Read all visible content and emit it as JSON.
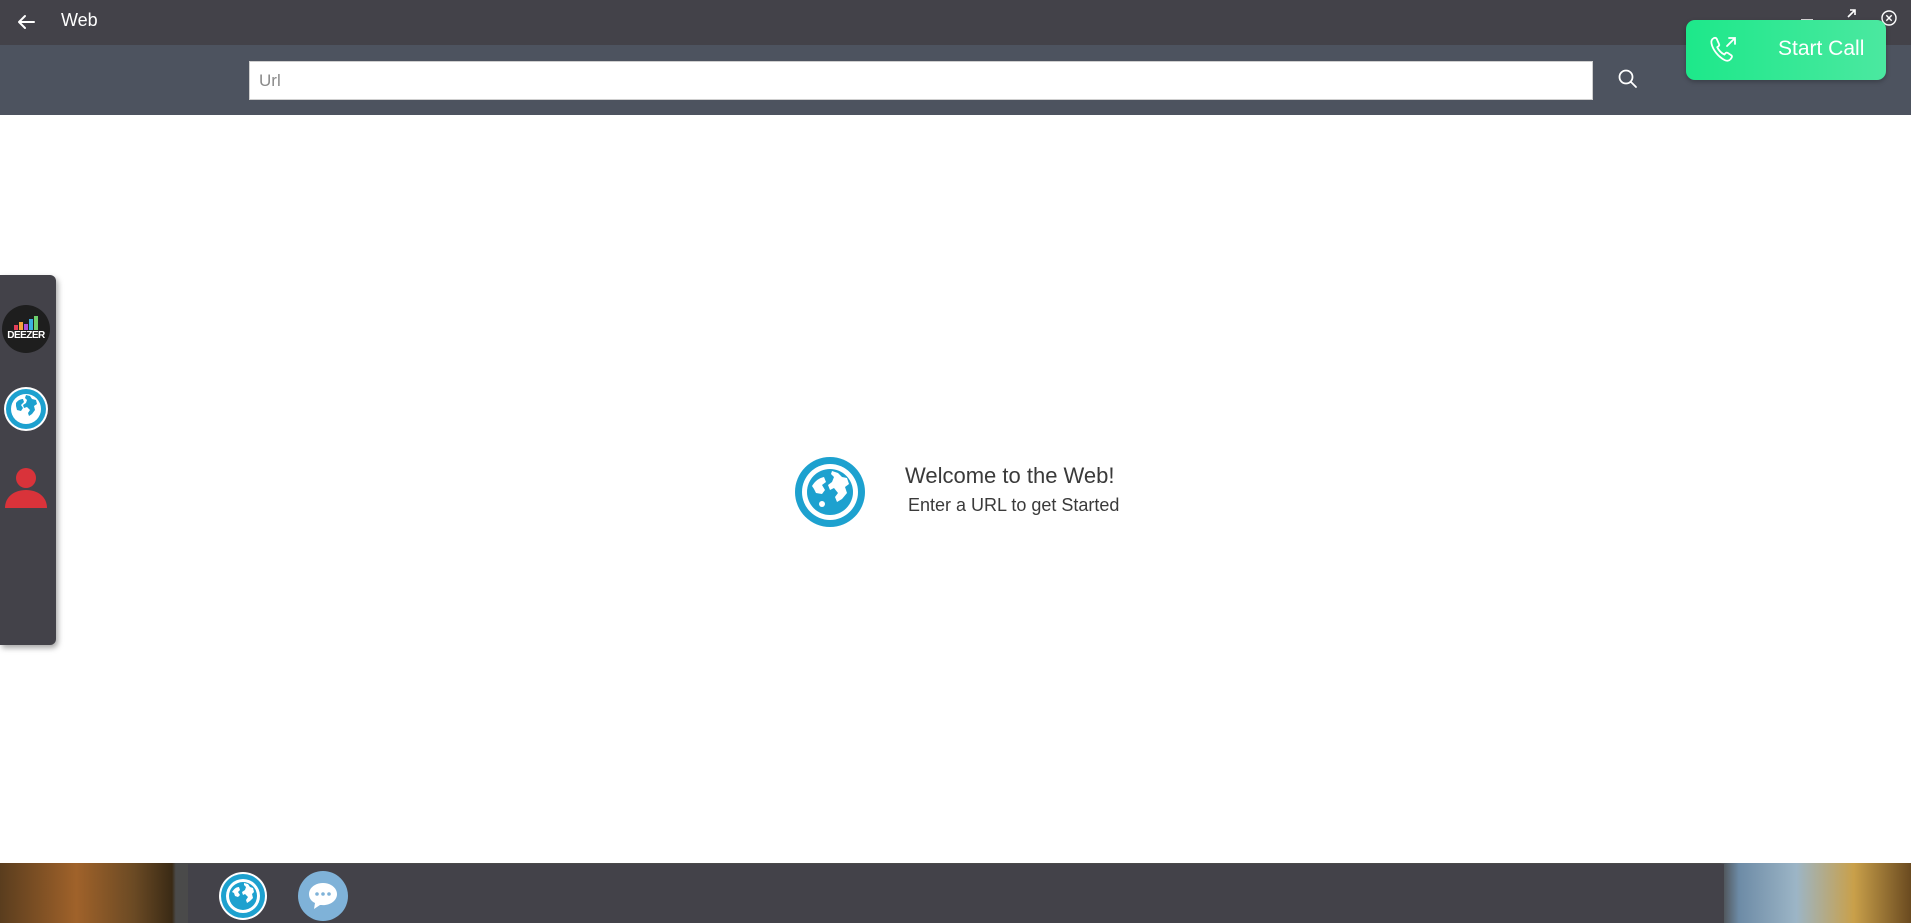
{
  "window": {
    "title": "Web"
  },
  "urlbar": {
    "placeholder": "Url",
    "value": ""
  },
  "call": {
    "label": "Start Call"
  },
  "side_dock": {
    "items": [
      {
        "name": "Deezer",
        "label": "DEEZER",
        "icon": "deezer-icon"
      },
      {
        "name": "Web",
        "icon": "globe-icon"
      },
      {
        "name": "Contacts",
        "icon": "person-icon"
      }
    ]
  },
  "welcome": {
    "title": "Welcome to the Web!",
    "subtitle": "Enter a URL to get Started"
  },
  "taskbar": {
    "items": [
      {
        "name": "Web",
        "icon": "globe-icon"
      },
      {
        "name": "Chat",
        "icon": "chat-bubble-icon"
      }
    ]
  },
  "colors": {
    "titlebar": "#434249",
    "urlbar": "#4d535f",
    "accent_globe": "#1da1cf",
    "call_green": "#1de88a",
    "person_red": "#d9333a"
  }
}
